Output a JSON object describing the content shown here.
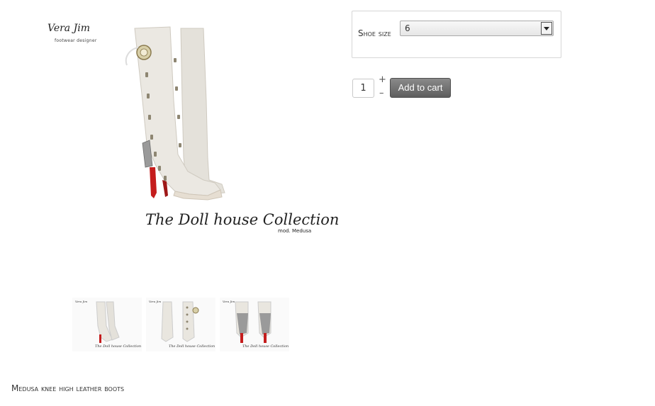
{
  "main_image": {
    "brand": "Vera Jim",
    "brand_tagline": "footwear designer",
    "collection": "The Doll house Collection",
    "model": "mod. Medusa"
  },
  "thumbnails": [
    {
      "brand": "Vera Jim",
      "collection": "The Doll house Collection"
    },
    {
      "brand": "Vera Jim",
      "collection": "The Doll house Collection"
    },
    {
      "brand": "Vera Jim",
      "collection": "The Doll house Collection"
    }
  ],
  "options": {
    "shoe_size_label": "Shoe size",
    "shoe_size_value": "6"
  },
  "cart": {
    "quantity": "1",
    "plus": "+",
    "minus": "–",
    "add_label": "Add to cart"
  },
  "product": {
    "name": "Medusa knee high leather boots"
  },
  "colors": {
    "boot": "#e9e6df",
    "heel_sole": "#c51d1d",
    "button": "#6e6e6e"
  }
}
